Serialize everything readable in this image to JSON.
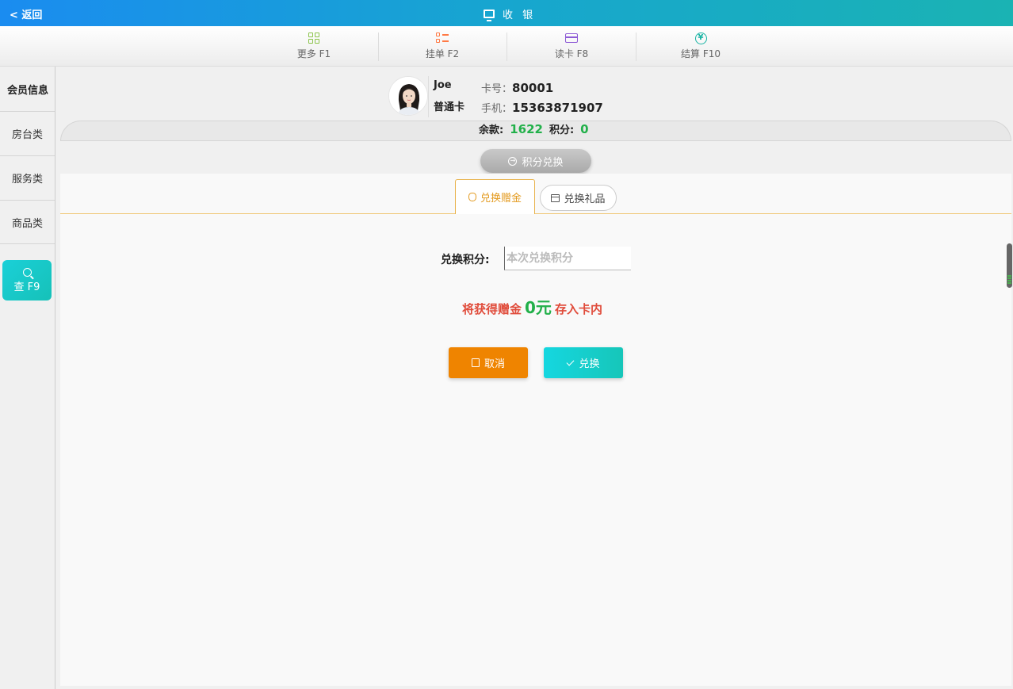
{
  "header": {
    "back_label": "< 返回",
    "title": "收 银",
    "title_icon": "monitor-icon"
  },
  "toolbar": {
    "items": [
      {
        "label": "更多 F1",
        "icon": "grid-icon",
        "color": "#8bc34a"
      },
      {
        "label": "挂单 F2",
        "icon": "list-icon",
        "color": "#ff7a45"
      },
      {
        "label": "读卡 F8",
        "icon": "card-icon",
        "color": "#8e5bd6"
      },
      {
        "label": "结算 F10",
        "icon": "yen-icon",
        "color": "#17b3a3"
      }
    ]
  },
  "sidebar": {
    "header": "会员信息",
    "items": [
      {
        "label": "房台类"
      },
      {
        "label": "服务类"
      },
      {
        "label": "商品类"
      }
    ],
    "search_label": "查 F9"
  },
  "member": {
    "name": "Joe",
    "card_type": "普通卡",
    "card_no_label": "卡号：",
    "card_no": "80001",
    "phone_label": "手机：",
    "phone": "15363871907",
    "balance_label": "余款:",
    "balance": "1622",
    "points_label": "积分:",
    "points": "0"
  },
  "points_exchange_button": "积分兑换",
  "tabs": [
    {
      "label": "兑换赠金",
      "active": true,
      "icon": "money-bag-icon"
    },
    {
      "label": "兑换礼品",
      "active": false,
      "icon": "gift-icon"
    }
  ],
  "form": {
    "label": "兑换积分:",
    "placeholder": "本次兑换积分",
    "value": ""
  },
  "reward": {
    "prefix": "将获得赠金",
    "amount": "0元",
    "suffix": "存入卡内"
  },
  "buttons": {
    "cancel": "取消",
    "confirm": "兑换"
  },
  "colors": {
    "header_start": "#1a8cf0",
    "header_end": "#1ab3b3",
    "accent_teal": "#16c6b9",
    "cancel_orange": "#ef8400",
    "active_tab": "#e39a1f",
    "number_green": "#22b04a",
    "reward_red": "#e04b3a"
  }
}
